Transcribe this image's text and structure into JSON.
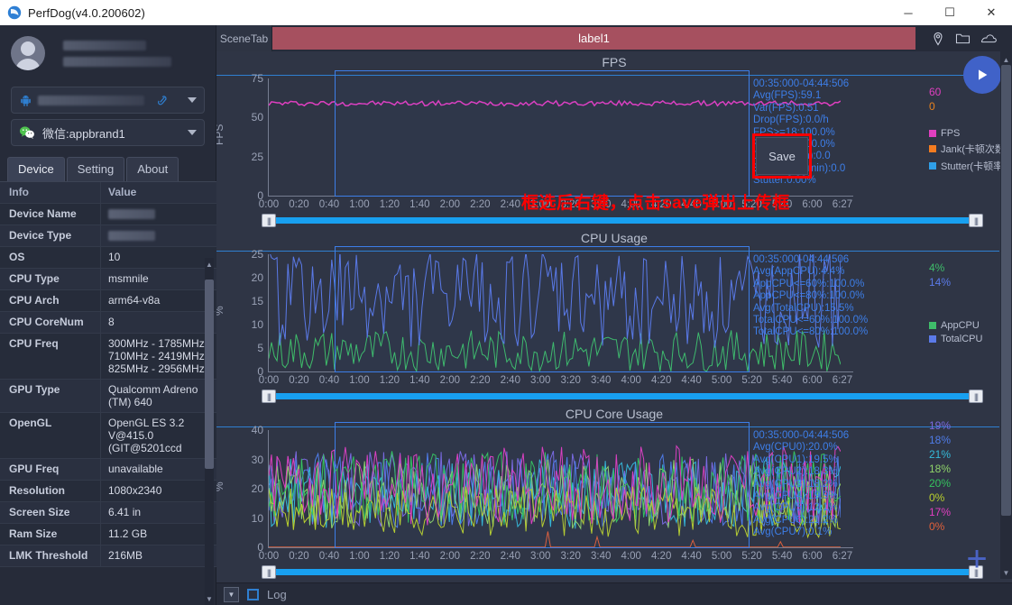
{
  "window": {
    "title": "PerfDog(v4.0.200602)",
    "app_icon": "perfdog-logo-icon",
    "minimize": "─",
    "maximize": "☐",
    "close": "✕"
  },
  "sidebar": {
    "device_combo": {
      "icon": "android-icon",
      "value": "",
      "link_icon": "usb-link-icon",
      "caret": "▼"
    },
    "app_combo": {
      "icon": "wechat-icon",
      "value": "微信:appbrand1",
      "caret": "▼"
    },
    "tabs": [
      {
        "label": "Device",
        "active": true
      },
      {
        "label": "Setting",
        "active": false
      },
      {
        "label": "About",
        "active": false
      }
    ],
    "table": {
      "headers": [
        "Info",
        "Value"
      ],
      "rows": [
        {
          "info": "Device Name",
          "value": "",
          "blurred": true
        },
        {
          "info": "Device Type",
          "value": "",
          "blurred": true
        },
        {
          "info": "OS",
          "value": "10"
        },
        {
          "info": "CPU Type",
          "value": "msmnile"
        },
        {
          "info": "CPU Arch",
          "value": "arm64-v8a"
        },
        {
          "info": "CPU CoreNum",
          "value": "8"
        },
        {
          "info": "CPU Freq",
          "value": "300MHz - 1785MHz\n710MHz - 2419MHz\n825MHz - 2956MHz"
        },
        {
          "info": "GPU Type",
          "value": "Qualcomm Adreno (TM) 640"
        },
        {
          "info": "OpenGL",
          "value": "OpenGL ES 3.2 V@415.0 (GIT@5201ccd"
        },
        {
          "info": "GPU Freq",
          "value": "unavailable"
        },
        {
          "info": "Resolution",
          "value": "1080x2340"
        },
        {
          "info": "Screen Size",
          "value": "6.41 in"
        },
        {
          "info": "Ram Size",
          "value": "11.2 GB"
        },
        {
          "info": "LMK Threshold",
          "value": "216MB"
        }
      ]
    }
  },
  "tabbar": {
    "scene_tab": "SceneTab",
    "label": "label1",
    "label_color": "#a6505f",
    "icons": [
      "location-pin-icon",
      "folder-icon",
      "cloud-icon"
    ]
  },
  "overlay": {
    "context_menu_item": "Save",
    "annotation": "框选后右键，点击save弹出上传框",
    "annotation_color": "#ff0000",
    "play_button": "play-icon",
    "add_button": "+"
  },
  "statusbar": {
    "dropdown": "▼",
    "log_label": "Log",
    "log_checked": false
  },
  "chart_data": [
    {
      "type": "line",
      "title": "FPS",
      "ylabel": "FPS",
      "xlabel": "",
      "ylim": [
        0,
        75
      ],
      "yticks": [
        0,
        25,
        50,
        75
      ],
      "xticks": [
        "0:00",
        "0:20",
        "0:40",
        "1:00",
        "1:20",
        "1:40",
        "2:00",
        "2:20",
        "2:40",
        "3:00",
        "3:20",
        "3:40",
        "4:00",
        "4:20",
        "4:40",
        "5:00",
        "5:20",
        "5:40",
        "6:00",
        "6:27"
      ],
      "grid": false,
      "legend_position": "right",
      "stats": [
        "00:35:000-04:44:506",
        "Avg(FPS):59.1",
        "Var(FPS):0.51",
        "Drop(FPS):0.0/h",
        "FPS>=18:100.0%",
        "FPS>=25:100.0%",
        "Jank(/10min):0.0",
        "BigJank(/10min):0.0",
        "Stutter:0.00%"
      ],
      "current_values": [
        {
          "label": "60",
          "color": "#e03fc0"
        },
        {
          "label": "0",
          "color": "#e8821e"
        }
      ],
      "legend": [
        {
          "name": "FPS",
          "color": "#e03fc0"
        },
        {
          "name": "Jank(卡顿次数)",
          "color": "#f47c20"
        },
        {
          "name": "Stutter(卡顿率)",
          "color": "#2f9fe8"
        }
      ],
      "series": [
        {
          "name": "FPS",
          "color": "#e03fc0",
          "mean": 59.1,
          "min": 57,
          "max": 61
        }
      ]
    },
    {
      "type": "line",
      "title": "CPU Usage",
      "ylabel": "%",
      "xlabel": "",
      "ylim": [
        0,
        25
      ],
      "yticks": [
        0,
        5,
        10,
        15,
        20,
        25
      ],
      "xticks": [
        "0:00",
        "0:20",
        "0:40",
        "1:00",
        "1:20",
        "1:40",
        "2:00",
        "2:20",
        "2:40",
        "3:00",
        "3:20",
        "3:40",
        "4:00",
        "4:20",
        "4:40",
        "5:00",
        "5:20",
        "5:40",
        "6:00",
        "6:27"
      ],
      "grid": false,
      "legend_position": "right",
      "stats": [
        "00:35:000-04:44:506",
        "Avg(AppCPU):4.4%",
        "AppCPU<=60%:100.0%",
        "AppCPU<=80%:100.0%",
        "Avg(TotalCPU):15.5%",
        "TotalCPU<=60%:100.0%",
        "TotalCPU<=80%:100.0%"
      ],
      "current_values": [
        {
          "label": "4%",
          "color": "#3fbd6a"
        },
        {
          "label": "14%",
          "color": "#5b7ae8"
        }
      ],
      "legend": [
        {
          "name": "AppCPU",
          "color": "#3fbd6a"
        },
        {
          "name": "TotalCPU",
          "color": "#5b7ae8"
        }
      ],
      "series": [
        {
          "name": "AppCPU",
          "color": "#3fbd6a",
          "mean": 4.4
        },
        {
          "name": "TotalCPU",
          "color": "#5b7ae8",
          "mean": 15.5
        }
      ]
    },
    {
      "type": "line",
      "title": "CPU Core Usage",
      "ylabel": "%",
      "xlabel": "",
      "ylim": [
        0,
        40
      ],
      "yticks": [
        0,
        10,
        20,
        30,
        40
      ],
      "xticks": [
        "0:00",
        "0:20",
        "0:40",
        "1:00",
        "1:20",
        "1:40",
        "2:00",
        "2:20",
        "2:40",
        "3:00",
        "3:20",
        "3:40",
        "4:00",
        "4:20",
        "4:40",
        "5:00",
        "5:20",
        "5:40",
        "6:00",
        "6:27"
      ],
      "grid": false,
      "legend_position": "right",
      "stats": [
        "00:35:000-04:44:506",
        "Avg(CPU0):20.0%",
        "Avg(CPU1):19.5%",
        "Avg(CPU2):18.3%",
        "Avg(CPU3):18.2%",
        "Avg(CPU4):19.9%",
        "Avg(CPU5):12.1%",
        "Avg(CPU6):21.2%",
        "Avg(CPU7):0.1%"
      ],
      "current_values": [
        {
          "label": "19%",
          "color": "#7b6ae0"
        },
        {
          "label": "18%",
          "color": "#4f7ce8"
        },
        {
          "label": "21%",
          "color": "#35b9d8"
        },
        {
          "label": "18%",
          "color": "#8fd36a"
        },
        {
          "label": "20%",
          "color": "#35c25e"
        },
        {
          "label": "0%",
          "color": "#b9d02e"
        },
        {
          "label": "17%",
          "color": "#e03fc0"
        },
        {
          "label": "0%",
          "color": "#e0603a"
        }
      ],
      "legend": [],
      "series": [
        {
          "name": "CPU0",
          "color": "#7b6ae0",
          "mean": 20.0
        },
        {
          "name": "CPU1",
          "color": "#4f7ce8",
          "mean": 19.5
        },
        {
          "name": "CPU2",
          "color": "#35b9d8",
          "mean": 18.3
        },
        {
          "name": "CPU3",
          "color": "#8fd36a",
          "mean": 18.2
        },
        {
          "name": "CPU4",
          "color": "#35c25e",
          "mean": 19.9
        },
        {
          "name": "CPU5",
          "color": "#b9d02e",
          "mean": 12.1
        },
        {
          "name": "CPU6",
          "color": "#e03fc0",
          "mean": 21.2
        },
        {
          "name": "CPU7",
          "color": "#e0603a",
          "mean": 0.1
        }
      ]
    }
  ]
}
